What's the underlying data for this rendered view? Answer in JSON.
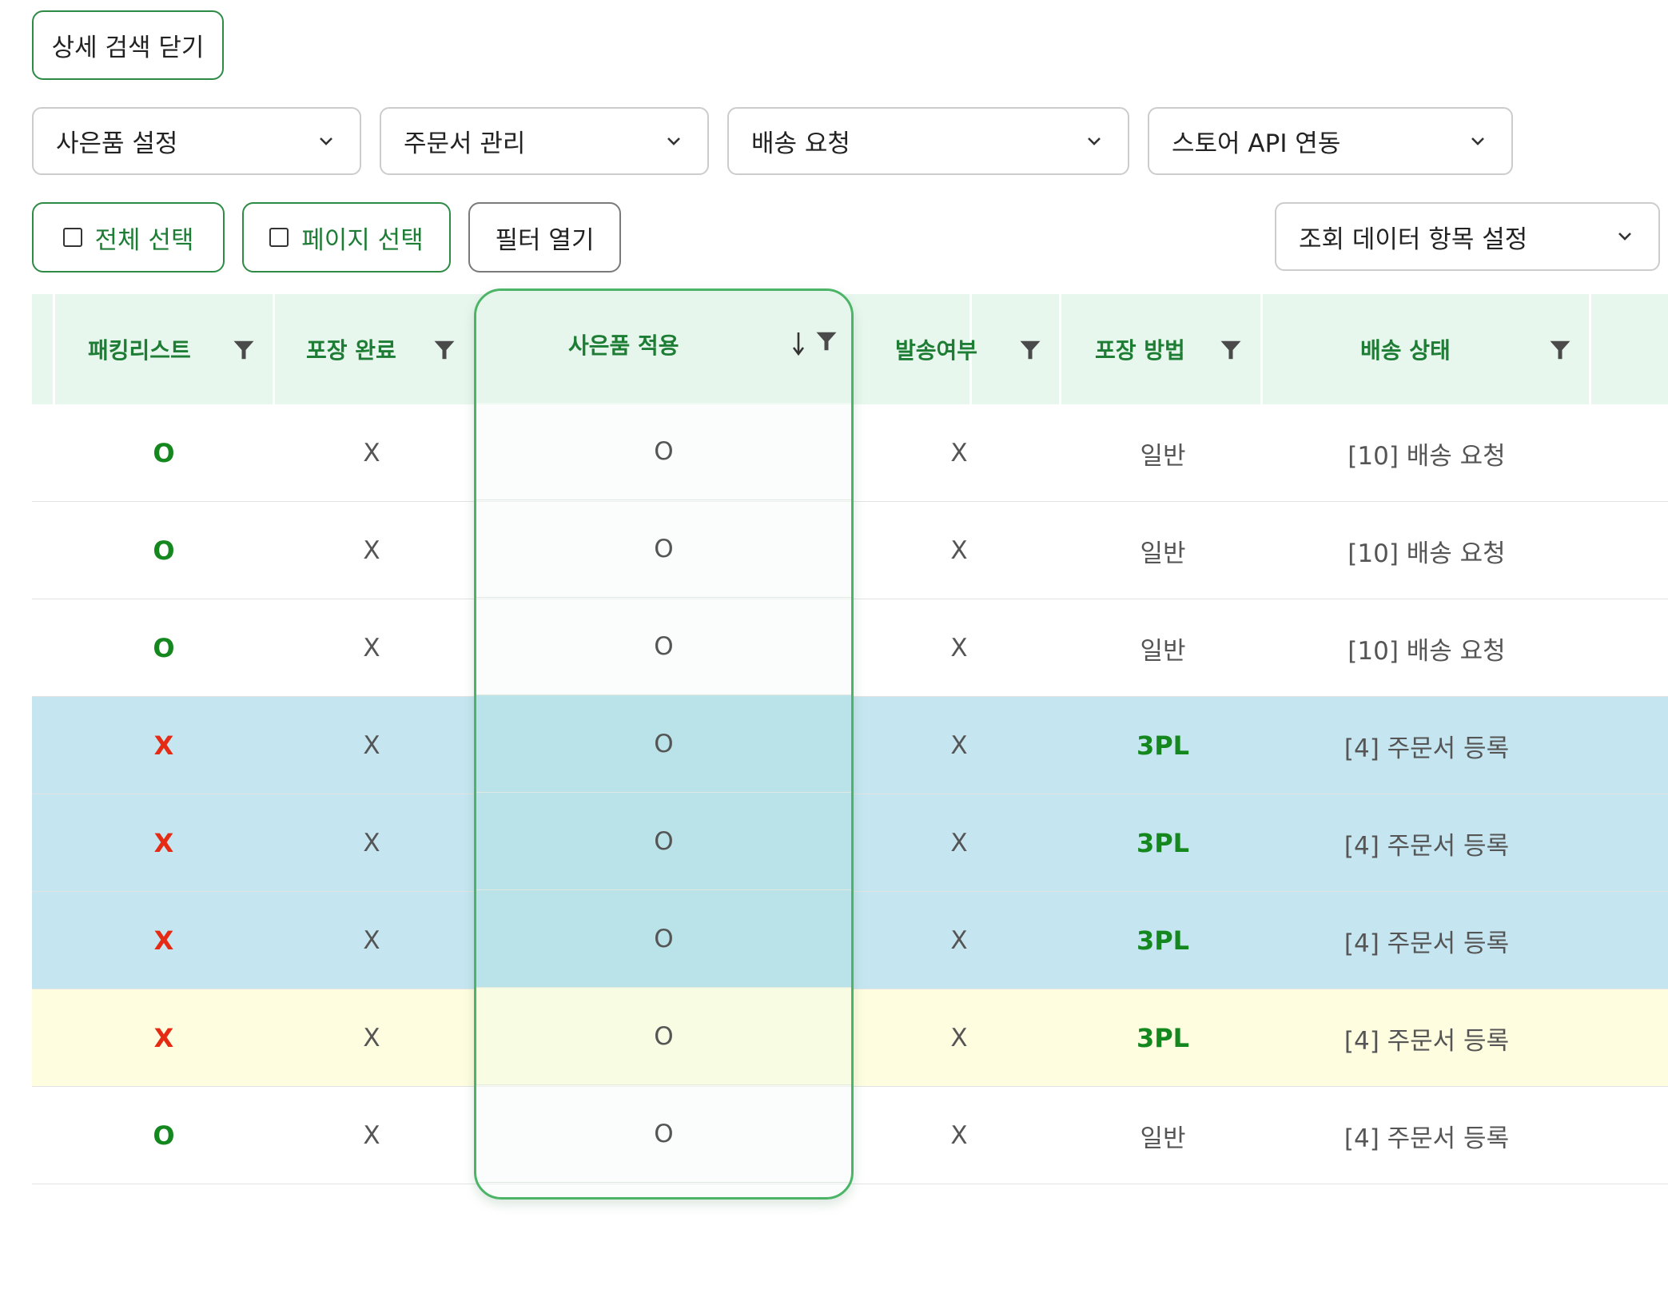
{
  "buttons": {
    "close_detail_search": "상세 검색 닫기",
    "select_all": "전체 선택",
    "select_page": "페이지 선택",
    "open_filter": "필터 열기"
  },
  "dropdowns": {
    "gift_settings": "사은품 설정",
    "order_management": "주문서 관리",
    "delivery_request": "배송 요청",
    "store_api": "스토어 API 연동",
    "view_columns": "조회 데이터 항목 설정"
  },
  "table": {
    "headers": {
      "packing_list": "패킹리스트",
      "packing_done": "포장 완료",
      "gift_applied": "사은품 적용",
      "shipped": "발송여부",
      "packing_method": "포장 방법",
      "delivery_status": "배송 상태"
    },
    "rows": [
      {
        "packing_list": "O",
        "packing_done": "X",
        "gift_applied": "O",
        "shipped": "X",
        "packing_method": "일반",
        "delivery_status": "[10] 배송 요청"
      },
      {
        "packing_list": "O",
        "packing_done": "X",
        "gift_applied": "O",
        "shipped": "X",
        "packing_method": "일반",
        "delivery_status": "[10] 배송 요청"
      },
      {
        "packing_list": "O",
        "packing_done": "X",
        "gift_applied": "O",
        "shipped": "X",
        "packing_method": "일반",
        "delivery_status": "[10] 배송 요청"
      },
      {
        "packing_list": "X",
        "packing_done": "X",
        "gift_applied": "O",
        "shipped": "X",
        "packing_method": "3PL",
        "delivery_status": "[4] 주문서 등록"
      },
      {
        "packing_list": "X",
        "packing_done": "X",
        "gift_applied": "O",
        "shipped": "X",
        "packing_method": "3PL",
        "delivery_status": "[4] 주문서 등록"
      },
      {
        "packing_list": "X",
        "packing_done": "X",
        "gift_applied": "O",
        "shipped": "X",
        "packing_method": "3PL",
        "delivery_status": "[4] 주문서 등록"
      },
      {
        "packing_list": "X",
        "packing_done": "X",
        "gift_applied": "O",
        "shipped": "X",
        "packing_method": "3PL",
        "delivery_status": "[4] 주문서 등록"
      },
      {
        "packing_list": "O",
        "packing_done": "X",
        "gift_applied": "O",
        "shipped": "X",
        "packing_method": "일반",
        "delivery_status": "[4] 주문서 등록"
      }
    ]
  },
  "colors": {
    "accent_green": "#1e7d34",
    "value_green": "#14871f",
    "value_red": "#e52b14",
    "header_bg": "#e8f7ee",
    "row_blue": "#c5e6f1",
    "row_yellow": "#fefde0"
  },
  "icons": [
    "funnel-icon",
    "chevron-down-icon",
    "sort-down-arrow-icon",
    "checkbox-icon"
  ]
}
